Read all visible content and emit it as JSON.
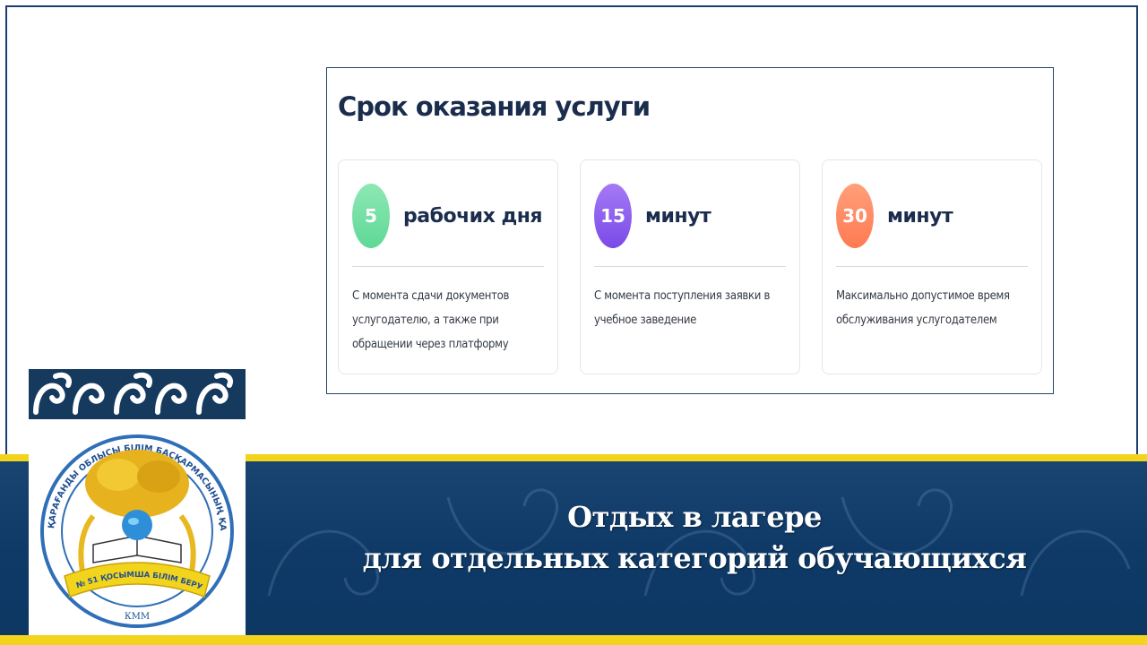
{
  "card": {
    "title": "Срок оказания услуги",
    "tiles": [
      {
        "number": "5",
        "unit": "рабочих дня",
        "description": "С момента сдачи документов услугодателю, а также при обращении через платформу",
        "color": "#6fe0a0"
      },
      {
        "number": "15",
        "unit": "минут",
        "description": "С момента поступления заявки в учебное заведение",
        "color": "#8a5cf0"
      },
      {
        "number": "30",
        "unit": "минут",
        "description": "Максимально допустимое время обслуживания услугодателем",
        "color": "#ff8a5e"
      }
    ]
  },
  "banner": {
    "title_line1": "Отдых в лагере",
    "title_line2": "для отдельных категорий обучающихся",
    "accent_color": "#f2d41c",
    "background_color": "#12406d"
  },
  "logo": {
    "ring_text": "ҚАРАҒАНДЫ ОБЛЫСЫ БІЛІМ БАСҚАРМАСЫНЫҢ ҚАРАҒАНДЫ ҚАЛАСЫ БІЛІМ БӨЛІМІНІҢ",
    "ribbon_text": "№ 51 ҚОСЫМША БІЛІМ БЕРУ МЕКТЕП - ОРТАЛЫҒЫ",
    "bottom_text": "КММ"
  }
}
